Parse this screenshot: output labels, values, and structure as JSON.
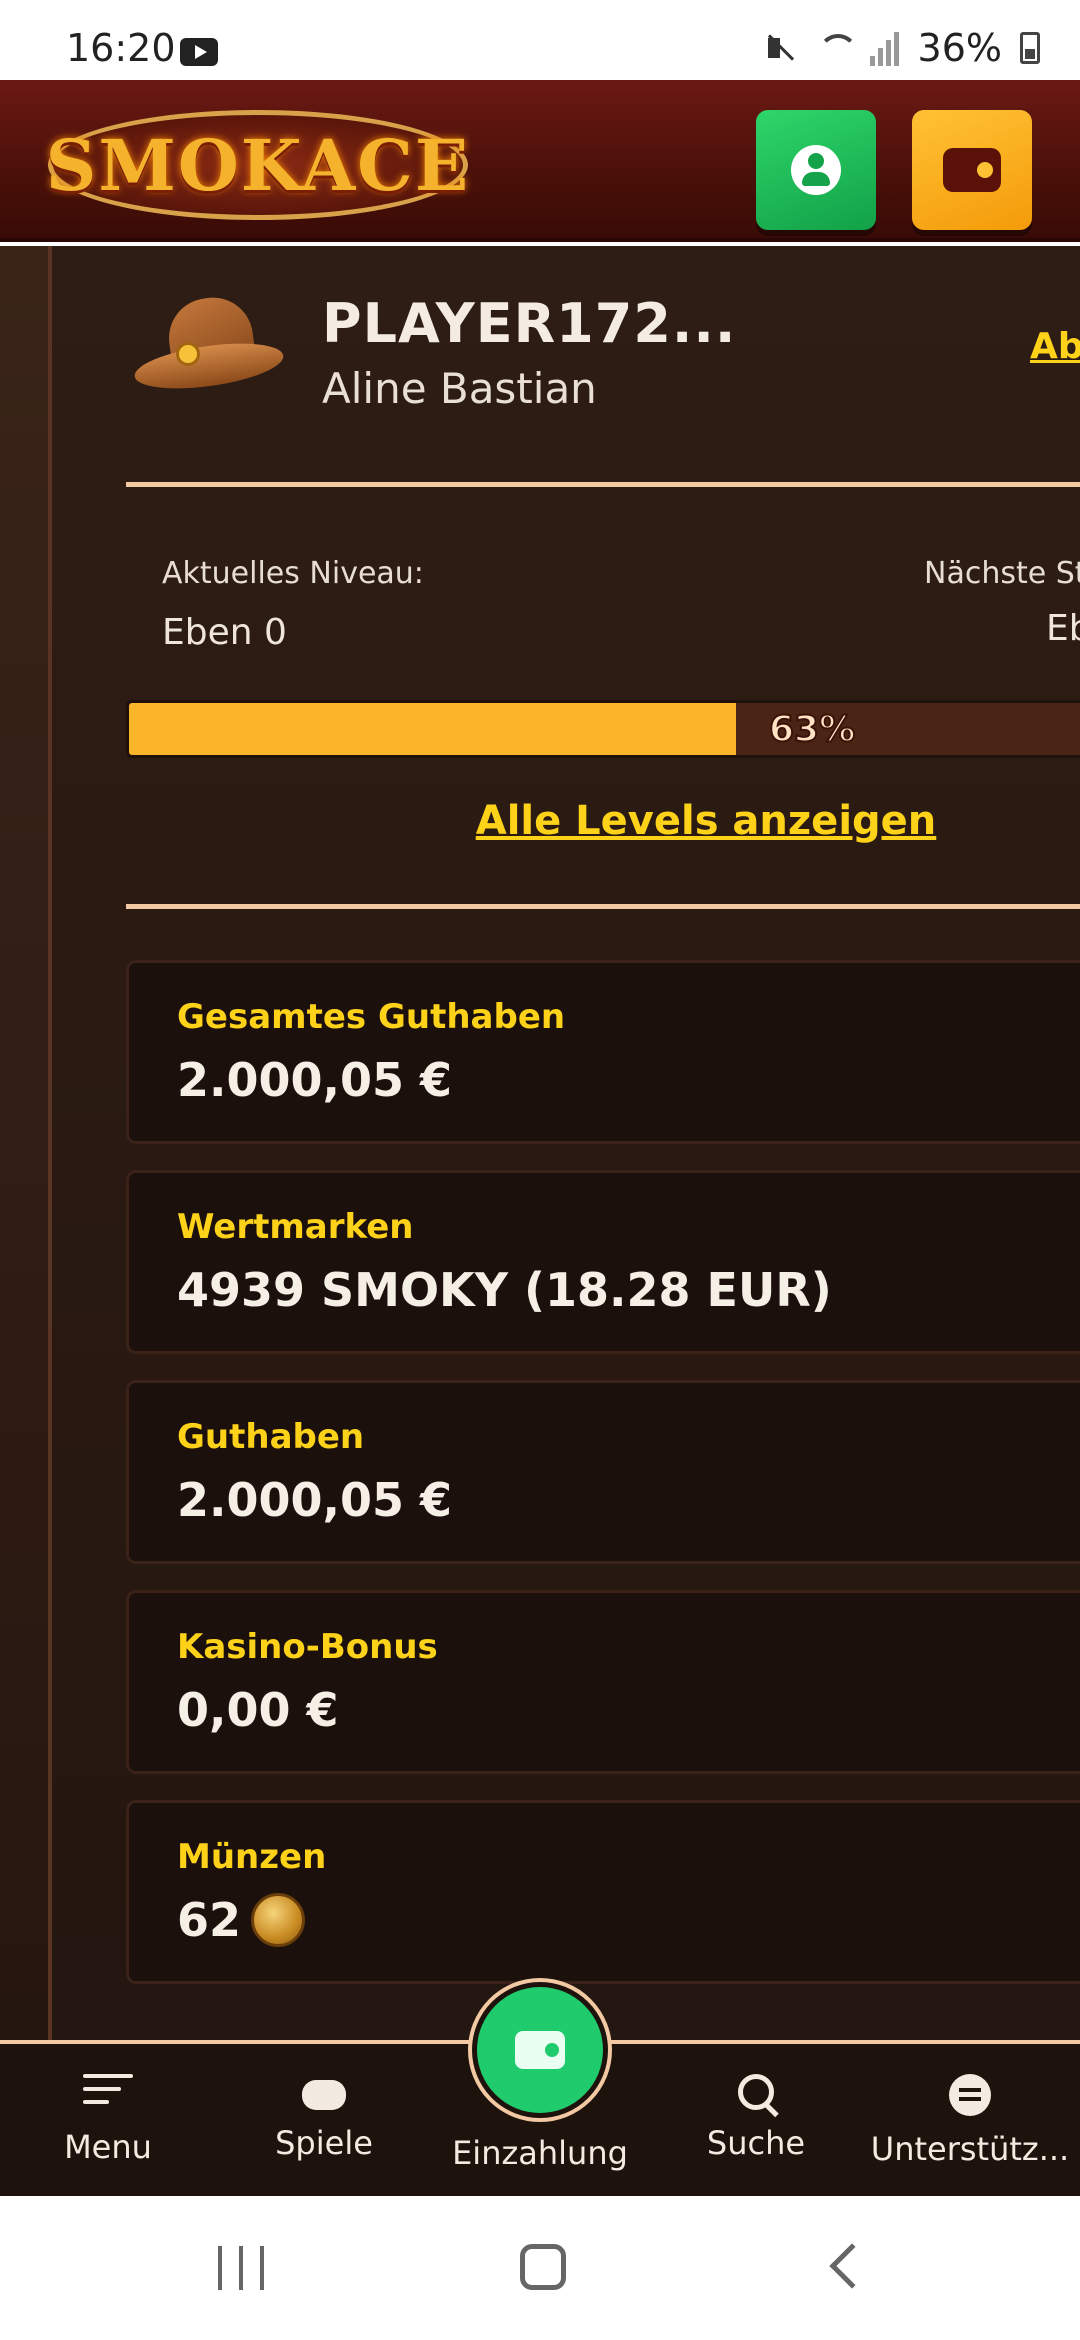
{
  "status_bar": {
    "time": "16:20",
    "battery": "36%",
    "icons": [
      "youtube-icon",
      "mute-icon",
      "wifi-icon",
      "signal-icon",
      "battery-icon"
    ]
  },
  "header": {
    "logo_text": "SMOKACE",
    "buttons": [
      "profile-button",
      "wallet-button"
    ]
  },
  "profile": {
    "player_id": "PLAYER172...",
    "name": "Aline Bastian",
    "logout_label": "Ab"
  },
  "level": {
    "current_label": "Aktuelles Niveau:",
    "current_value": "Eben 0",
    "next_label": "Nächste St",
    "next_value": "Eb",
    "progress_percent": 63,
    "progress_text": "63%",
    "all_levels_link": "Alle Levels anzeigen"
  },
  "balances": [
    {
      "label": "Gesamtes Guthaben",
      "value": "2.000,05 €"
    },
    {
      "label": "Wertmarken",
      "value": "4939 SMOKY (18.28 EUR)"
    },
    {
      "label": "Guthaben",
      "value": "2.000,05 €"
    },
    {
      "label": "Kasino-Bonus",
      "value": "0,00 €"
    },
    {
      "label": "Münzen",
      "value": "62"
    }
  ],
  "bottom_nav": {
    "items": [
      {
        "label": "Menu",
        "icon": "menu-icon"
      },
      {
        "label": "Spiele",
        "icon": "gamepad-icon"
      },
      {
        "label": "Einzahlung",
        "icon": "wallet-icon"
      },
      {
        "label": "Suche",
        "icon": "search-icon"
      },
      {
        "label": "Unterstütz...",
        "icon": "chat-icon"
      }
    ]
  },
  "colors": {
    "accent_yellow": "#ffd21a",
    "progress_fill": "#fbb52a",
    "deposit_green": "#1fcb6d",
    "header_red": "#6b1a12",
    "card_bg": "#1b100b"
  }
}
